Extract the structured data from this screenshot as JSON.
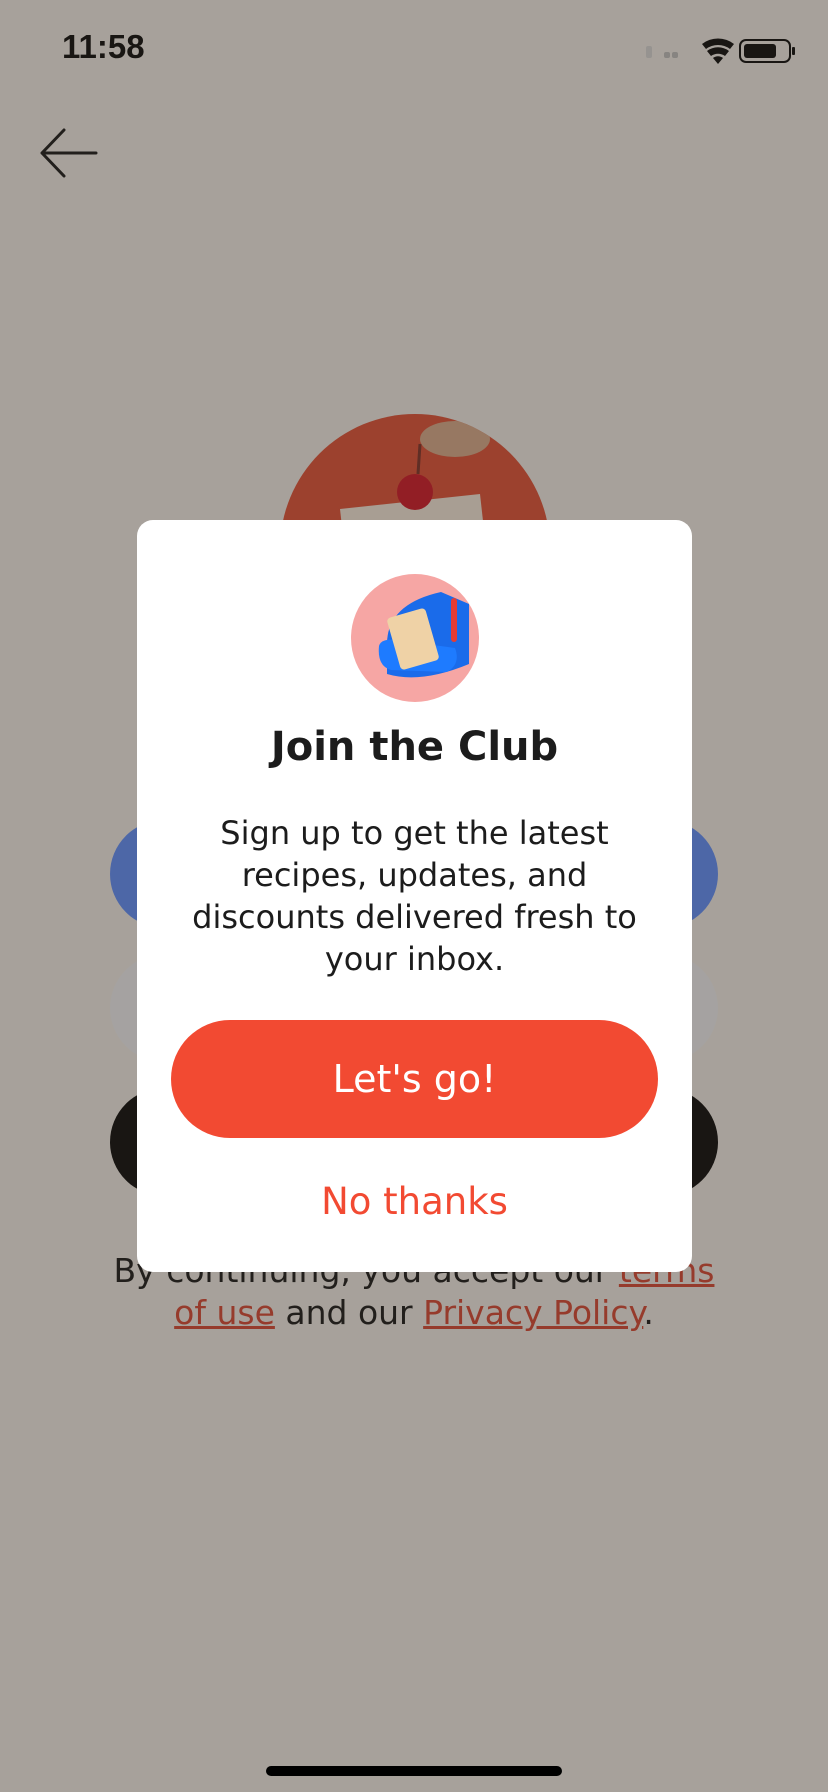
{
  "status_bar": {
    "time": "11:58"
  },
  "icons": {
    "back": "arrow-left-icon",
    "wifi": "wifi-icon",
    "battery": "battery-icon",
    "signal": "cellular-signal-icon"
  },
  "legal": {
    "prefix": "By continuing, you accept our ",
    "terms_link": "terms of use",
    "middle": " and our ",
    "privacy_link": "Privacy Policy",
    "suffix": "."
  },
  "modal": {
    "title": "Join the Club",
    "body": "Sign up to get the latest recipes, updates, and discounts delivered fresh to your inbox.",
    "primary_button": "Let's go!",
    "secondary_button": "No thanks"
  },
  "colors": {
    "accent": "#f24a32",
    "modal_background": "#ffffff",
    "overlay": "rgba(60,52,45,0.42)",
    "illustration_bg": "#f6a6a4"
  }
}
